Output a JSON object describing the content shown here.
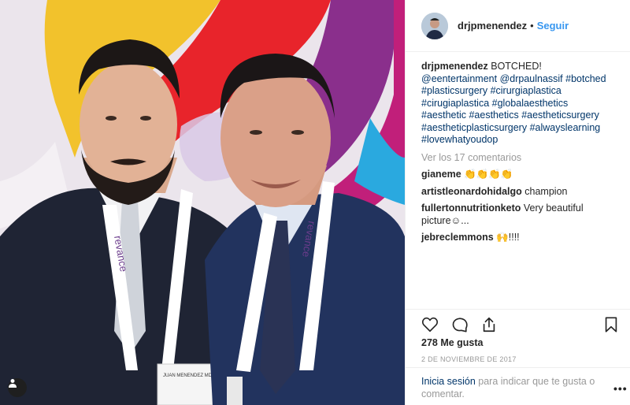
{
  "post": {
    "author": "drjpmenendez",
    "separator": "•",
    "follow_label": "Seguir",
    "caption_text": "BOTCHED!",
    "caption_tags": [
      "@eentertainment",
      "@drpaulnassif",
      "#botched",
      "#plasticsurgery",
      "#cirurgiaplastica",
      "#cirugiaplastica",
      "#globalaesthetics",
      "#aesthetic",
      "#aesthetics",
      "#aestheticsurgery",
      "#aestheticplasticsurgery",
      "#alwayslearning",
      "#lovewhatyoudop"
    ],
    "view_all_comments": "Ver los 17 comentarios",
    "comments": [
      {
        "user": "gianeme",
        "text": "👏👏👏👏"
      },
      {
        "user": "artistleonardohidalgo",
        "text": "champion"
      },
      {
        "user": "fullertonnutritionketo",
        "text": "Very beautiful picture☺..."
      },
      {
        "user": "jebreclemmons",
        "text": "🙌!!!!"
      }
    ],
    "likes": "278 Me gusta",
    "date": "2 DE NOVIEMBRE DE 2017",
    "login_link": "Inicia sesión",
    "login_rest": "para indicar que te gusta o comentar.",
    "more_label": "•••"
  },
  "photo": {
    "lanyard_text": "revance",
    "badge_text": "JUAN MENENDEZ MD"
  },
  "icons": {
    "heart": "heart-icon",
    "comment": "comment-icon",
    "share": "share-icon",
    "bookmark": "bookmark-icon",
    "tag": "user-tag-icon",
    "more": "more-options-icon"
  },
  "colors": {
    "link": "#003569",
    "follow": "#3897f0",
    "muted": "#999999",
    "text": "#262626"
  }
}
